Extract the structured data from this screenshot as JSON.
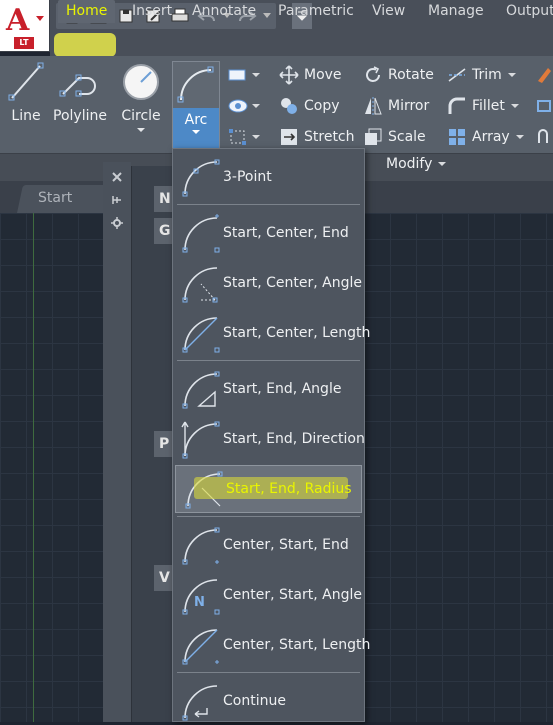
{
  "app": {
    "logo_letter": "A",
    "edition": "LT"
  },
  "ribbon_tabs": [
    "Home",
    "Insert",
    "Annotate",
    "Parametric",
    "View",
    "Manage",
    "Output"
  ],
  "draw_tools": {
    "line": "Line",
    "polyline": "Polyline",
    "circle": "Circle",
    "arc": "Arc"
  },
  "modify_tools": {
    "move": "Move",
    "rotate": "Rotate",
    "trim": "Trim",
    "copy": "Copy",
    "mirror": "Mirror",
    "fillet": "Fillet",
    "stretch": "Stretch",
    "scale": "Scale",
    "array": "Array"
  },
  "modify_panel_title": "Modify",
  "file_tab": "Start",
  "palette_letters": [
    "N",
    "G",
    "P",
    "V"
  ],
  "arc_menu": {
    "items": [
      {
        "label": "3-Point",
        "icon": "arc-3point-icon"
      },
      {
        "label": "Start, Center, End",
        "icon": "arc-start-center-end-icon"
      },
      {
        "label": "Start, Center, Angle",
        "icon": "arc-start-center-angle-icon"
      },
      {
        "label": "Start, Center, Length",
        "icon": "arc-start-center-length-icon"
      },
      {
        "label": "Start, End, Angle",
        "icon": "arc-start-end-angle-icon"
      },
      {
        "label": "Start, End, Direction",
        "icon": "arc-start-end-direction-icon"
      },
      {
        "label": "Start, End, Radius",
        "icon": "arc-start-end-radius-icon",
        "selected": true
      },
      {
        "label": "Center, Start, End",
        "icon": "arc-center-start-end-icon"
      },
      {
        "label": "Center, Start, Angle",
        "icon": "arc-center-start-angle-icon"
      },
      {
        "label": "Center, Start, Length",
        "icon": "arc-center-start-length-icon"
      },
      {
        "label": "Continue",
        "icon": "arc-continue-icon"
      }
    ]
  },
  "colors": {
    "accent_yellow": "#e9f500",
    "highlight": "#d8d83a",
    "brand_red": "#c8202b",
    "arc_blue": "#4d89c7"
  }
}
